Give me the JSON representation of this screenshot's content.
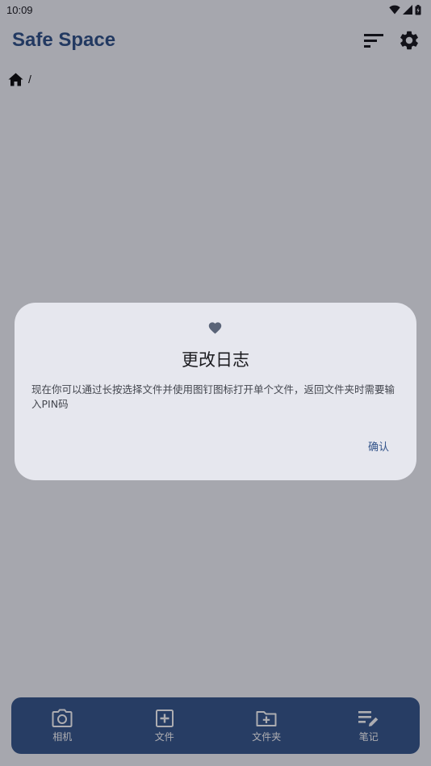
{
  "status_bar": {
    "time": "10:09"
  },
  "app_bar": {
    "title": "Safe Space"
  },
  "breadcrumb": {
    "separator": "/"
  },
  "bottom_nav": {
    "items": [
      {
        "label": "相机"
      },
      {
        "label": "文件"
      },
      {
        "label": "文件夹"
      },
      {
        "label": "笔记"
      }
    ]
  },
  "dialog": {
    "title": "更改日志",
    "body": "现在你可以通过长按选择文件并使用图钉图标打开单个文件，返回文件夹时需要输入PIN码",
    "confirm_label": "确认"
  },
  "colors": {
    "accent": "#33548a",
    "nav_bg": "#3a5a8e",
    "dialog_bg": "#e6e7ee",
    "scrim": "rgba(0,0,12,0.32)"
  }
}
